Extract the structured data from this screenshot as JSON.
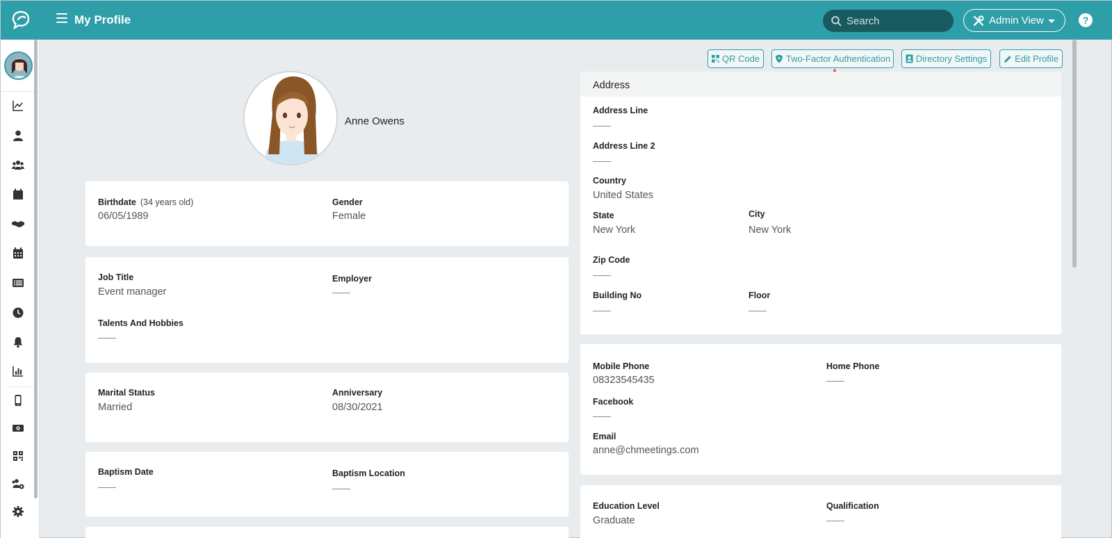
{
  "header": {
    "title": "My Profile",
    "search_placeholder": "Search",
    "admin_view_label": "Admin View",
    "help_label": "?"
  },
  "actions": {
    "qr_code": "QR Code",
    "two_factor": "Two-Factor Authentication",
    "directory_settings": "Directory Settings",
    "edit_profile": "Edit Profile"
  },
  "profile": {
    "name": "Anne Owens"
  },
  "personal": {
    "birthdate_label": "Birthdate",
    "birthdate_age": "(34 years old)",
    "birthdate_value": "06/05/1989",
    "gender_label": "Gender",
    "gender_value": "Female"
  },
  "work": {
    "job_title_label": "Job Title",
    "job_title_value": "Event manager",
    "employer_label": "Employer",
    "talents_label": "Talents And Hobbies"
  },
  "family": {
    "marital_label": "Marital Status",
    "marital_value": "Married",
    "anniversary_label": "Anniversary",
    "anniversary_value": "08/30/2021"
  },
  "baptism": {
    "date_label": "Baptism Date",
    "location_label": "Baptism Location"
  },
  "address": {
    "section_title": "Address",
    "line1_label": "Address Line",
    "line2_label": "Address Line 2",
    "country_label": "Country",
    "country_value": "United States",
    "state_label": "State",
    "state_value": "New York",
    "city_label": "City",
    "city_value": "New York",
    "zip_label": "Zip Code",
    "building_label": "Building No",
    "floor_label": "Floor"
  },
  "contact": {
    "mobile_label": "Mobile Phone",
    "mobile_value": "08323545435",
    "home_label": "Home Phone",
    "facebook_label": "Facebook",
    "email_label": "Email",
    "email_value": "anne@chmeetings.com"
  },
  "education": {
    "level_label": "Education Level",
    "level_value": "Graduate",
    "qualification_label": "Qualification"
  },
  "sidebar_icons": [
    "chart-line-icon",
    "user-icon",
    "users-icon",
    "calendar-icon",
    "handshake-icon",
    "calendar-grid-icon",
    "list-icon",
    "clock-icon",
    "bell-icon",
    "bar-chart-icon",
    "mobile-icon",
    "money-icon",
    "qr-icon",
    "user-group-gear-icon",
    "settings-icon"
  ],
  "colors": {
    "accent": "#2e9ea8",
    "annotation_arrow": "#f5393d"
  }
}
